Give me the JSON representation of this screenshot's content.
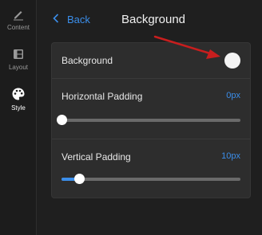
{
  "sidebar": {
    "items": [
      {
        "label": "Content",
        "icon": "pencil-icon"
      },
      {
        "label": "Layout",
        "icon": "layout-icon"
      },
      {
        "label": "Style",
        "icon": "palette-icon",
        "active": true
      }
    ]
  },
  "header": {
    "back_label": "Back",
    "title": "Background"
  },
  "panel": {
    "background": {
      "label": "Background",
      "toggle_color": "#f4f4f4"
    },
    "horizontal_padding": {
      "label": "Horizontal Padding",
      "value": "0px",
      "level": 0
    },
    "vertical_padding": {
      "label": "Vertical Padding",
      "value": "10px",
      "level": 0.1
    }
  },
  "colors": {
    "accent": "#3b8eea",
    "annotation_arrow": "#c81e1e"
  }
}
